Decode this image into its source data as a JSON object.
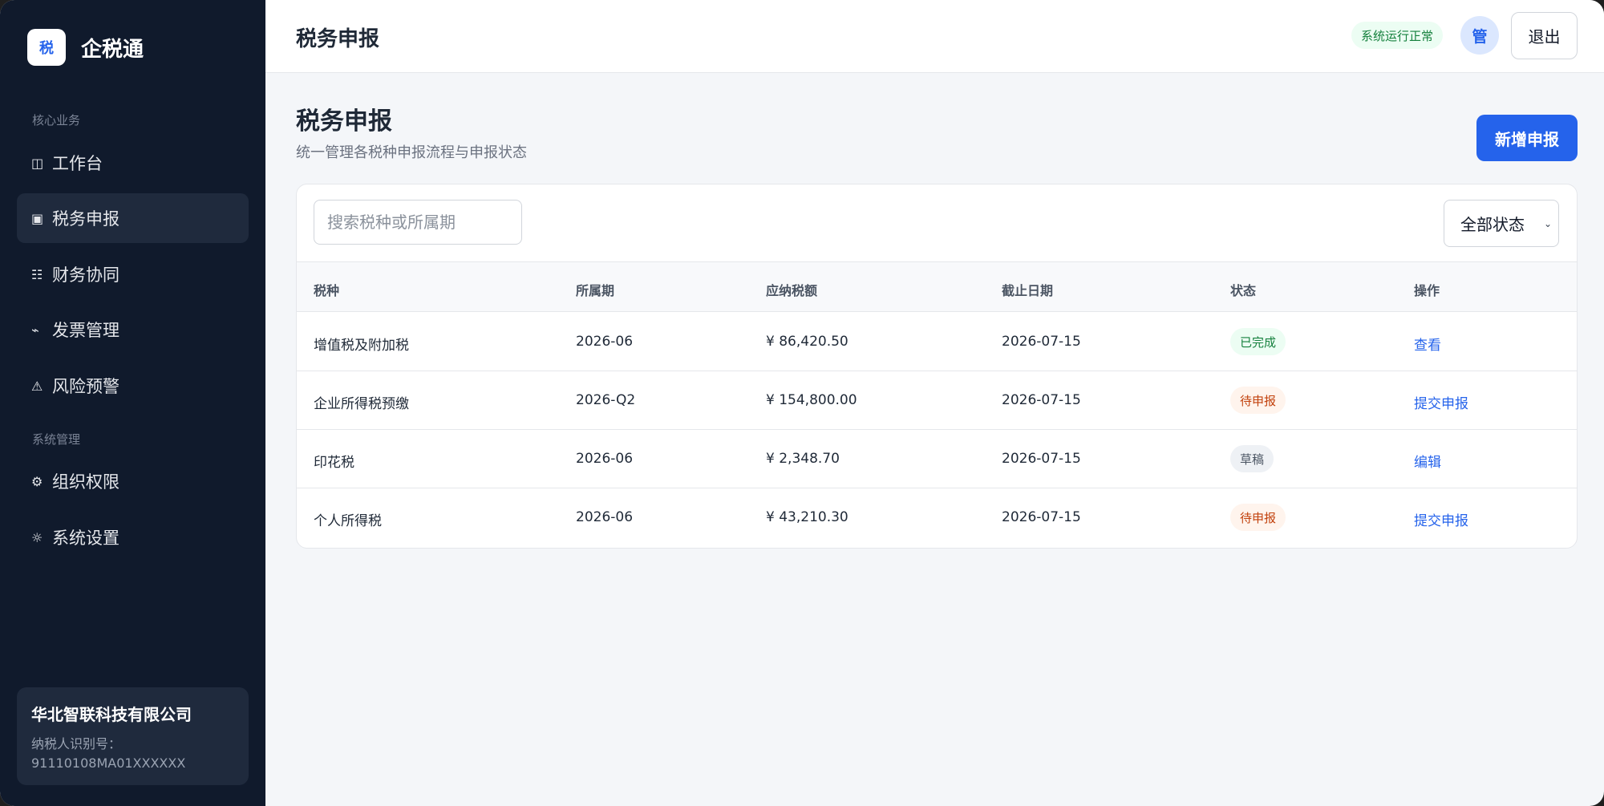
{
  "brand": {
    "logo_char": "税",
    "name": "企税通"
  },
  "sidebar": {
    "section_core": "核心业务",
    "section_system": "系统管理",
    "items": [
      {
        "icon": "◫",
        "label": "工作台"
      },
      {
        "icon": "▣",
        "label": "税务申报"
      },
      {
        "icon": "☷",
        "label": "财务协同"
      },
      {
        "icon": "⌁",
        "label": "发票管理"
      },
      {
        "icon": "⚠",
        "label": "风险预警"
      },
      {
        "icon": "⚙",
        "label": "组织权限"
      },
      {
        "icon": "☼",
        "label": "系统设置"
      }
    ],
    "active_index": 1
  },
  "company": {
    "name": "华北智联科技有限公司",
    "tax_id_label": "纳税人识别号：",
    "tax_id": "91110108MA01XXXXXX"
  },
  "topbar": {
    "title": "税务申报",
    "status": "系统运行正常",
    "avatar": "管",
    "logout": "退出"
  },
  "page": {
    "title": "税务申报",
    "subtitle": "统一管理各税种申报流程与申报状态",
    "new_button": "新增申报"
  },
  "filters": {
    "search_placeholder": "搜索税种或所属期",
    "status_selected": "全部状态"
  },
  "table": {
    "headers": [
      "税种",
      "所属期",
      "应纳税额",
      "截止日期",
      "状态",
      "操作"
    ],
    "rows": [
      {
        "type": "增值税及附加税",
        "period": "2026-06",
        "amount": "¥ 86,420.50",
        "due": "2026-07-15",
        "status": "已完成",
        "status_kind": "done",
        "action": "查看"
      },
      {
        "type": "企业所得税预缴",
        "period": "2026-Q2",
        "amount": "¥ 154,800.00",
        "due": "2026-07-15",
        "status": "待申报",
        "status_kind": "pending",
        "action": "提交申报"
      },
      {
        "type": "印花税",
        "period": "2026-06",
        "amount": "¥ 2,348.70",
        "due": "2026-07-15",
        "status": "草稿",
        "status_kind": "draft",
        "action": "编辑"
      },
      {
        "type": "个人所得税",
        "period": "2026-06",
        "amount": "¥ 43,210.30",
        "due": "2026-07-15",
        "status": "待申报",
        "status_kind": "pending",
        "action": "提交申报"
      }
    ]
  },
  "colors": {
    "sidebar_bg": "#101a2c",
    "accent": "#2563eb",
    "success": "#15803d",
    "warning": "#c2410c"
  }
}
